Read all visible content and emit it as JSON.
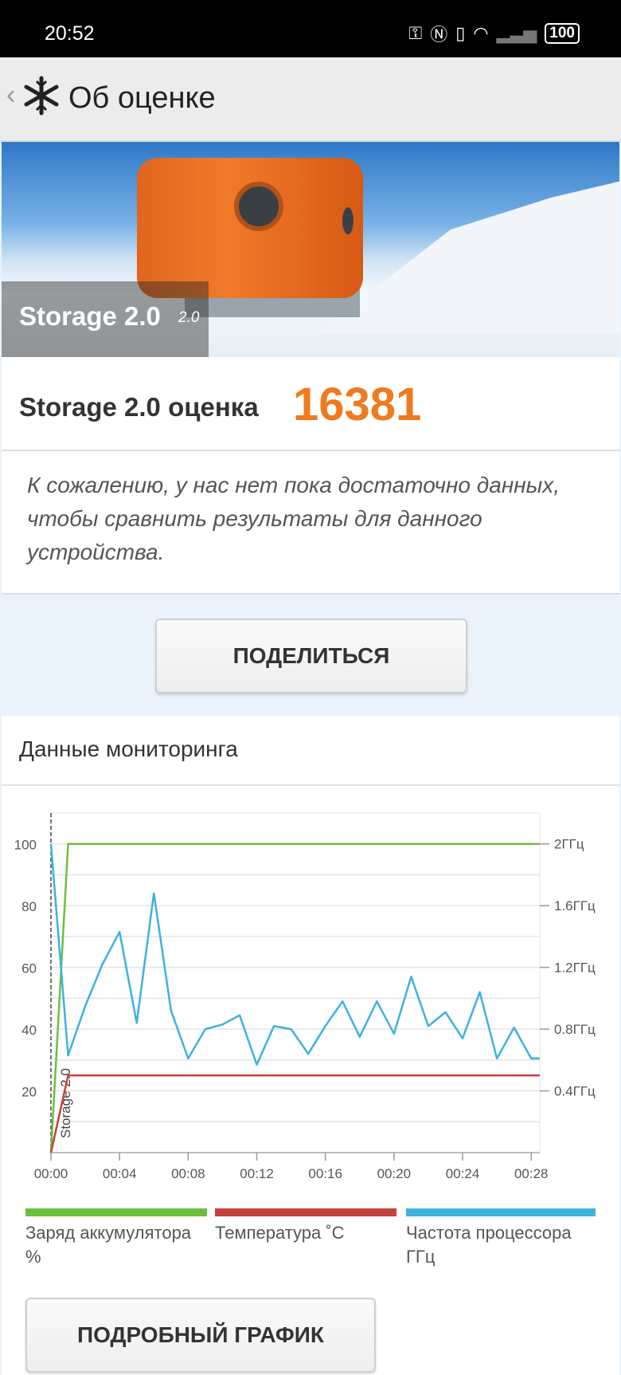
{
  "status_bar": {
    "time": "20:52",
    "battery": "100",
    "icons": [
      "key-icon",
      "nfc-icon",
      "vibrate-icon",
      "wifi-icon",
      "signal-icon",
      "battery-icon"
    ]
  },
  "app_bar": {
    "back_icon": "chevron-left-icon",
    "logo_icon": "snowflake-icon",
    "title": "Об оценке"
  },
  "hero": {
    "name": "Storage 2.0",
    "version": "2.0"
  },
  "score": {
    "label": "Storage 2.0 оценка",
    "value": "16381",
    "accent_color": "#f07a1e"
  },
  "message": "К сожалению, у нас нет пока достаточно данных, чтобы сравнить результаты для данного устройства.",
  "share_button": "ПОДЕЛИТЬСЯ",
  "monitoring": {
    "title": "Данные мониторинга",
    "detail_button": "ПОДРОБНЫЙ ГРАФИК",
    "legend": [
      {
        "label": "Заряд аккумулятора %",
        "color": "#6cbf3f"
      },
      {
        "label": "Температура ˚C",
        "color": "#c8403b"
      },
      {
        "label": "Частота процессора ГГц",
        "color": "#3fb1e0"
      }
    ]
  },
  "chart_data": {
    "type": "line",
    "marker_label": "Storage 2.0",
    "x_ticks": [
      "00:00",
      "00:04",
      "00:08",
      "00:12",
      "00:16",
      "00:20",
      "00:24",
      "00:28"
    ],
    "y_left_ticks": [
      "20",
      "40",
      "60",
      "80",
      "100"
    ],
    "y_right_ticks": [
      "0.4ГГц",
      "0.8ГГц",
      "1.2ГГц",
      "1.6ГГц",
      "2ГГц"
    ],
    "x_range_min": [
      0,
      28.5
    ],
    "y_left_range": [
      0,
      110
    ],
    "y_right_range": [
      0,
      2.2
    ],
    "grid": true,
    "series": [
      {
        "name": "Заряд аккумулятора %",
        "color": "#6cbf3f",
        "x": [
          0,
          1,
          28.5
        ],
        "y": [
          0,
          100,
          100
        ]
      },
      {
        "name": "Температура ˚C",
        "color": "#c8403b",
        "x": [
          0,
          1,
          28.5
        ],
        "y": [
          0,
          25,
          25
        ]
      },
      {
        "name": "Частота процессора ГГц",
        "color": "#3fb1e0",
        "x": [
          0,
          1,
          2,
          3,
          4,
          5,
          6,
          7,
          8,
          9,
          10,
          11,
          12,
          13,
          14,
          15,
          16,
          17,
          18,
          19,
          20,
          21,
          22,
          23,
          24,
          25,
          26,
          27,
          28,
          28.5
        ],
        "y_ghz": [
          2.0,
          0.63,
          0.95,
          1.22,
          1.43,
          0.84,
          1.68,
          0.92,
          0.61,
          0.8,
          0.83,
          0.89,
          0.57,
          0.82,
          0.8,
          0.64,
          0.82,
          0.98,
          0.75,
          0.98,
          0.77,
          1.14,
          0.82,
          0.91,
          0.74,
          1.04,
          0.61,
          0.81,
          0.61,
          0.61
        ]
      }
    ]
  }
}
